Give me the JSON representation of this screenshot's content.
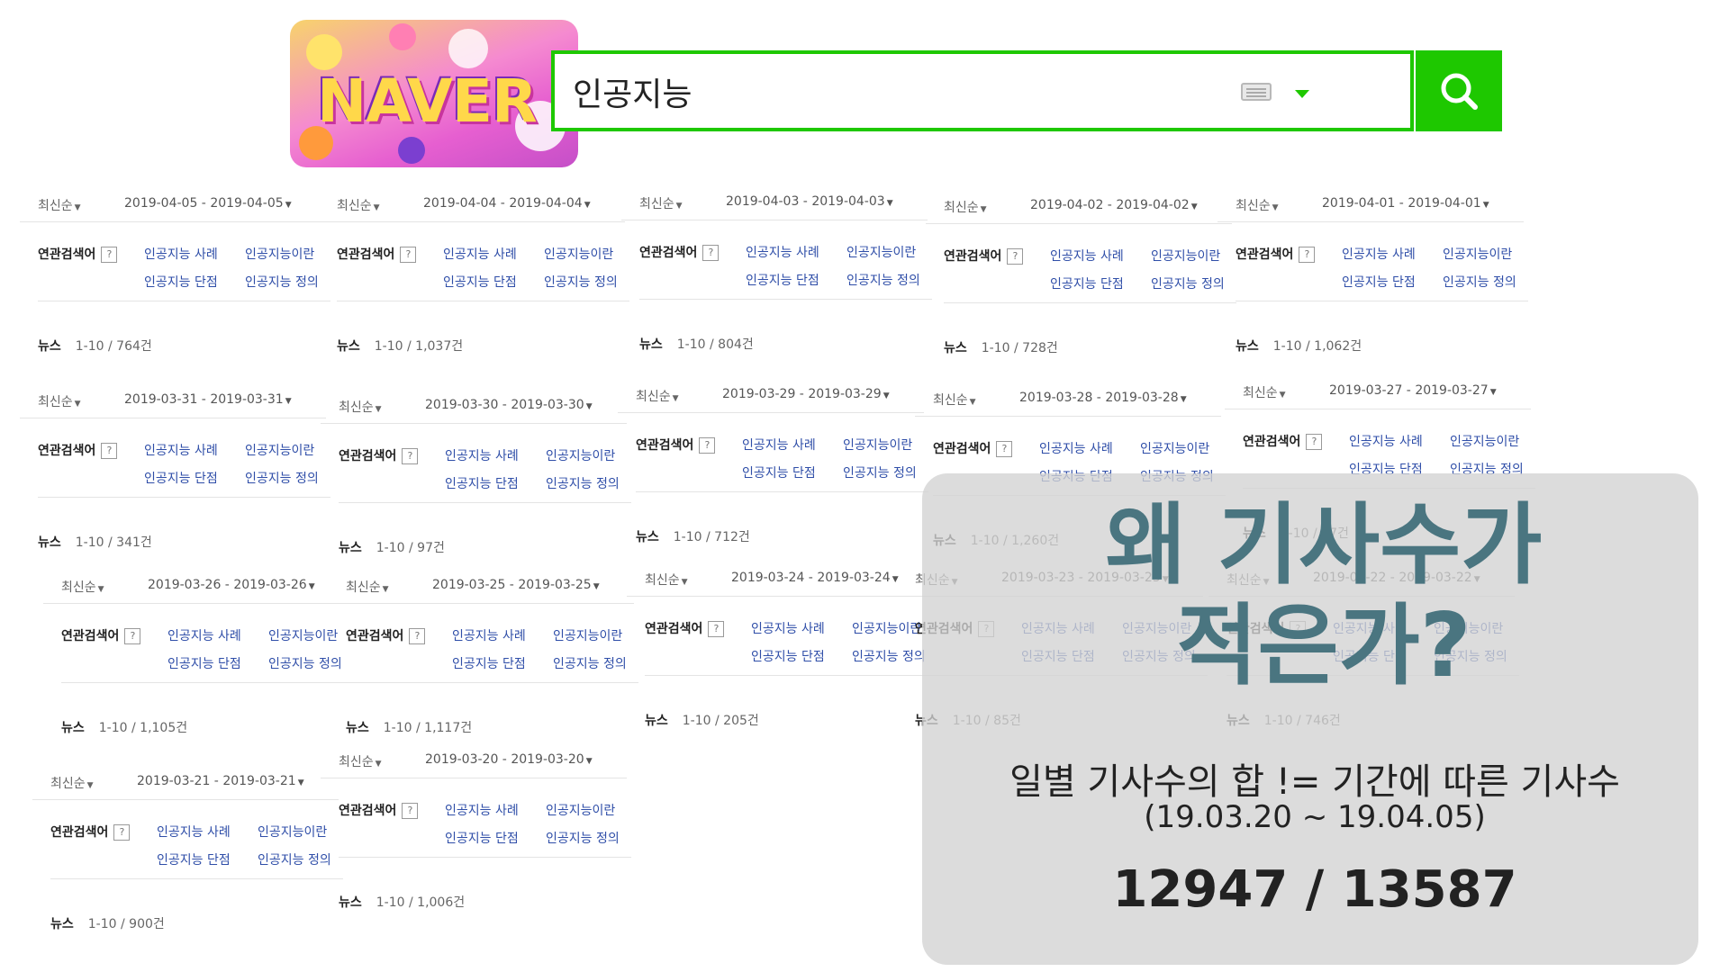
{
  "search": {
    "query": "인공지능"
  },
  "logo": {
    "text": "NAVER"
  },
  "blocks": [
    {
      "sort": "최신순",
      "date": "2019-04-05 - 2019-04-05",
      "related_label": "연관검색어",
      "tags": [
        "인공지능 사례",
        "인공지능이란",
        "인공지능 단점",
        "인공지능 정의"
      ],
      "news_label": "뉴스",
      "news_count": "1-10 / 764건"
    },
    {
      "sort": "최신순",
      "date": "2019-04-04 - 2019-04-04",
      "related_label": "연관검색어",
      "tags": [
        "인공지능 사례",
        "인공지능이란",
        "인공지능 단점",
        "인공지능 정의"
      ],
      "news_label": "뉴스",
      "news_count": "1-10 / 1,037건"
    },
    {
      "sort": "최신순",
      "date": "2019-04-03 - 2019-04-03",
      "related_label": "연관검색어",
      "tags": [
        "인공지능 사례",
        "인공지능이란",
        "인공지능 단점",
        "인공지능 정의"
      ],
      "news_label": "뉴스",
      "news_count": "1-10 / 804건"
    },
    {
      "sort": "최신순",
      "date": "2019-04-02 - 2019-04-02",
      "related_label": "연관검색어",
      "tags": [
        "인공지능 사례",
        "인공지능이란",
        "인공지능 단점",
        "인공지능 정의"
      ],
      "news_label": "뉴스",
      "news_count": "1-10 / 728건"
    },
    {
      "sort": "최신순",
      "date": "2019-04-01 - 2019-04-01",
      "related_label": "연관검색어",
      "tags": [
        "인공지능 사례",
        "인공지능이란",
        "인공지능 단점",
        "인공지능 정의"
      ],
      "news_label": "뉴스",
      "news_count": "1-10 / 1,062건"
    },
    {
      "sort": "최신순",
      "date": "2019-03-31 - 2019-03-31",
      "related_label": "연관검색어",
      "tags": [
        "인공지능 사례",
        "인공지능이란",
        "인공지능 단점",
        "인공지능 정의"
      ],
      "news_label": "뉴스",
      "news_count": "1-10 / 341건"
    },
    {
      "sort": "최신순",
      "date": "2019-03-30 - 2019-03-30",
      "related_label": "연관검색어",
      "tags": [
        "인공지능 사례",
        "인공지능이란",
        "인공지능 단점",
        "인공지능 정의"
      ],
      "news_label": "뉴스",
      "news_count": "1-10 / 97건"
    },
    {
      "sort": "최신순",
      "date": "2019-03-29 - 2019-03-29",
      "related_label": "연관검색어",
      "tags": [
        "인공지능 사례",
        "인공지능이란",
        "인공지능 단점",
        "인공지능 정의"
      ],
      "news_label": "뉴스",
      "news_count": "1-10 / 712건"
    },
    {
      "sort": "최신순",
      "date": "2019-03-28 - 2019-03-28",
      "related_label": "연관검색어",
      "tags": [
        "인공지능 사례",
        "인공지능이란",
        "인공지능 단점",
        "인공지능 정의"
      ],
      "news_label": "뉴스",
      "news_count": "1-10 / 1,260건"
    },
    {
      "sort": "최신순",
      "date": "2019-03-27 - 2019-03-27",
      "related_label": "연관검색어",
      "tags": [
        "인공지능 사례",
        "인공지능이란",
        "인공지능 단점",
        "인공지능 정의"
      ],
      "news_label": "뉴스",
      "news_count": "1-10 / 97건"
    },
    {
      "sort": "최신순",
      "date": "2019-03-26 - 2019-03-26",
      "related_label": "연관검색어",
      "tags": [
        "인공지능 사례",
        "인공지능이란",
        "인공지능 단점",
        "인공지능 정의"
      ],
      "news_label": "뉴스",
      "news_count": "1-10 / 1,105건"
    },
    {
      "sort": "최신순",
      "date": "2019-03-25 - 2019-03-25",
      "related_label": "연관검색어",
      "tags": [
        "인공지능 사례",
        "인공지능이란",
        "인공지능 단점",
        "인공지능 정의"
      ],
      "news_label": "뉴스",
      "news_count": "1-10 / 1,117건"
    },
    {
      "sort": "최신순",
      "date": "2019-03-24 - 2019-03-24",
      "related_label": "연관검색어",
      "tags": [
        "인공지능 사례",
        "인공지능이란",
        "인공지능 단점",
        "인공지능 정의"
      ],
      "news_label": "뉴스",
      "news_count": "1-10 / 205건"
    },
    {
      "sort": "최신순",
      "date": "2019-03-23 - 2019-03-23",
      "related_label": "연관검색어",
      "tags": [
        "인공지능 사례",
        "인공지능이란",
        "인공지능 단점",
        "인공지능 정의"
      ],
      "news_label": "뉴스",
      "news_count": "1-10 / 85건"
    },
    {
      "sort": "최신순",
      "date": "2019-03-22 - 2019-03-22",
      "related_label": "연관검색어",
      "tags": [
        "인공지능 사례",
        "인공지능이란",
        "인공지능 단점",
        "인공지능 정의"
      ],
      "news_label": "뉴스",
      "news_count": "1-10 / 746건"
    },
    {
      "sort": "최신순",
      "date": "2019-03-21 - 2019-03-21",
      "related_label": "연관검색어",
      "tags": [
        "인공지능 사례",
        "인공지능이란",
        "인공지능 단점",
        "인공지능 정의"
      ],
      "news_label": "뉴스",
      "news_count": "1-10 / 900건"
    },
    {
      "sort": "최신순",
      "date": "2019-03-20 - 2019-03-20",
      "related_label": "연관검색어",
      "tags": [
        "인공지능 사례",
        "인공지능이란",
        "인공지능 단점",
        "인공지능 정의"
      ],
      "news_label": "뉴스",
      "news_count": "1-10 / 1,006건"
    }
  ],
  "overlay": {
    "headline_line1": "왜 기사수가",
    "headline_line2": "적은가?",
    "subtitle": "일별 기사수의 합 != 기간에 따른 기사수",
    "range": "(19.03.20 ~ 19.04.05)",
    "counts": "12947 / 13587"
  },
  "colors": {
    "naver_green": "#1ec800",
    "link_blue": "#2f4ea8",
    "headline": "#4a7580"
  },
  "icons": {
    "search_button": "search-icon",
    "keyboard": "keyboard-icon",
    "dropdown": "caret-down-icon",
    "help": "question-icon"
  }
}
